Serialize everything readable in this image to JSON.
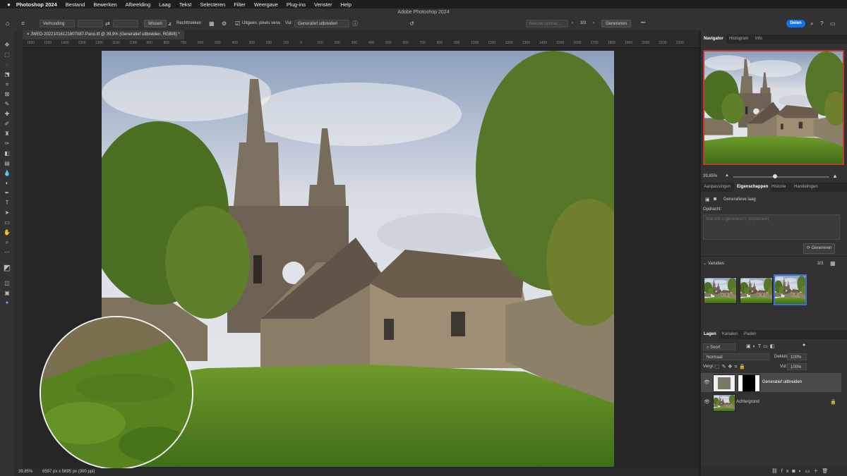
{
  "menubar": {
    "apple": "",
    "items": [
      "Photoshop 2024",
      "Bestand",
      "Bewerken",
      "Afbeelding",
      "Laag",
      "Tekst",
      "Selecteren",
      "Filter",
      "Weergave",
      "Plug-ins",
      "Venster",
      "Help"
    ]
  },
  "title": "Adobe Photoshop 2024",
  "options": {
    "ratio": "Verhouding",
    "clear": "Wissen",
    "straighten": "Rechttrekken",
    "content_aware": "Uitgeen. pixels verw.",
    "fill_label": "Vul:",
    "fill_value": "Generatief uitbreiden",
    "prompt_placeholder": "Nieuwe opdrac...",
    "variation_counter": "3/3",
    "generate": "Generenen",
    "share": "Delen"
  },
  "document": {
    "tab": "JWED-20221016121807087-Pano.tif @ 39,9% (Generatief uitbreiden, RGB/8) *",
    "zoom": "39,85%",
    "status": "6597 px x 5695 px (300 ppi)"
  },
  "ruler": [
    "1600",
    "1500",
    "1400",
    "1300",
    "1200",
    "1100",
    "1000",
    "900",
    "800",
    "700",
    "600",
    "500",
    "400",
    "300",
    "200",
    "100",
    "0",
    "100",
    "200",
    "300",
    "400",
    "500",
    "600",
    "700",
    "800",
    "900",
    "1000",
    "1100",
    "1200",
    "1300",
    "1400",
    "1500",
    "1600",
    "1700",
    "1800",
    "1900",
    "2000",
    "2100",
    "2200"
  ],
  "navigator": {
    "tabs": [
      "Navigator",
      "Histogram",
      "Info"
    ],
    "zoom": "39,85%"
  },
  "properties": {
    "tabs": [
      "Aanpassingen",
      "Eigenschappen",
      "Historie",
      "Handelingen"
    ],
    "layer_type": "Generatieve laag",
    "prompt_label": "Opdracht:",
    "prompt_placeholder": "Wat wilt u genereren? (Optioneel)",
    "generate": "Genereren",
    "variations_label": "Variaties",
    "variations_count": "3/3"
  },
  "layers": {
    "tabs": [
      "Lagen",
      "Kanalen",
      "Paden"
    ],
    "filter": "Soort",
    "blend": "Normaal",
    "opacity_label": "Dekking:",
    "opacity": "100%",
    "lock_label": "Vergr.:",
    "fill_label": "Vul:",
    "fill": "100%",
    "items": [
      "Generatief uitbreiden",
      "Achtergrond"
    ]
  },
  "colors": {
    "accent": "#1473e6",
    "selection": "#3d6fd6",
    "navigator_frame": "#c0392b"
  }
}
